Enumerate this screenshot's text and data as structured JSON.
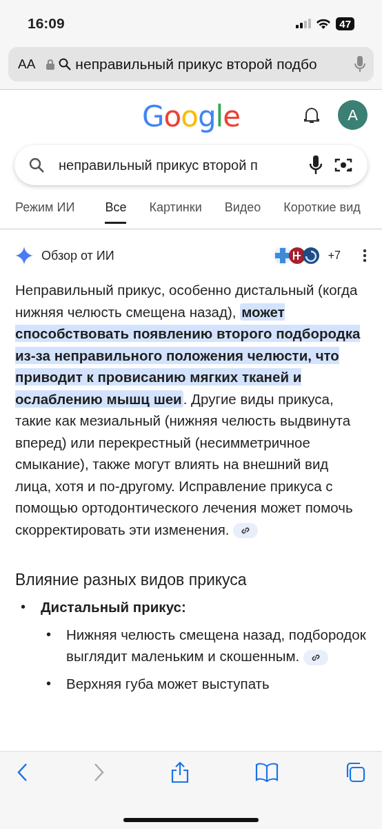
{
  "status_bar": {
    "time": "16:09",
    "battery": "47"
  },
  "address_bar": {
    "text_size_button": "AA",
    "url": "неправильный прикус второй подбо"
  },
  "header": {
    "logo": "Google",
    "avatar": "A"
  },
  "search": {
    "value": "неправильный прикус второй п"
  },
  "tabs": [
    {
      "label": "Режим ИИ",
      "selected": false
    },
    {
      "label": "Все",
      "selected": true
    },
    {
      "label": "Картинки",
      "selected": false
    },
    {
      "label": "Видео",
      "selected": false
    },
    {
      "label": "Короткие вид",
      "selected": false
    }
  ],
  "ai_overview": {
    "title": "Обзор от ИИ",
    "sources_more": "+7",
    "paragraph": [
      {
        "text": "Неправильный прикус, особенно дистальный (когда нижняя челюсть смещена назад), ",
        "highlighted": false
      },
      {
        "text": "может способствовать появлению второго подбородка из-за неправильного положения челюсти, что приводит к провисанию мягких тканей и ослаблению мышц шеи",
        "highlighted": true
      },
      {
        "text": ". Другие виды прикуса, такие как мезиальный (нижняя челюсть выдвинута вперед) или перекрестный (несимметричное смыкание), также могут влиять на внешний вид лица, хотя и по-другому. Исправление прикуса с помощью ортодонтического лечения может помочь скорректировать эти изменения.",
        "highlighted": false
      }
    ],
    "heading": "Влияние разных видов прикуса",
    "bullets": [
      {
        "marker": "•",
        "title": "Дистальный прикус:",
        "children": [
          {
            "marker": "•",
            "text": "Нижняя челюсть смещена назад, подбородок выглядит маленьким и скошенным.",
            "link": true
          },
          {
            "marker": "•",
            "text": "Верхняя губа может выступать",
            "link": false
          }
        ]
      }
    ]
  }
}
